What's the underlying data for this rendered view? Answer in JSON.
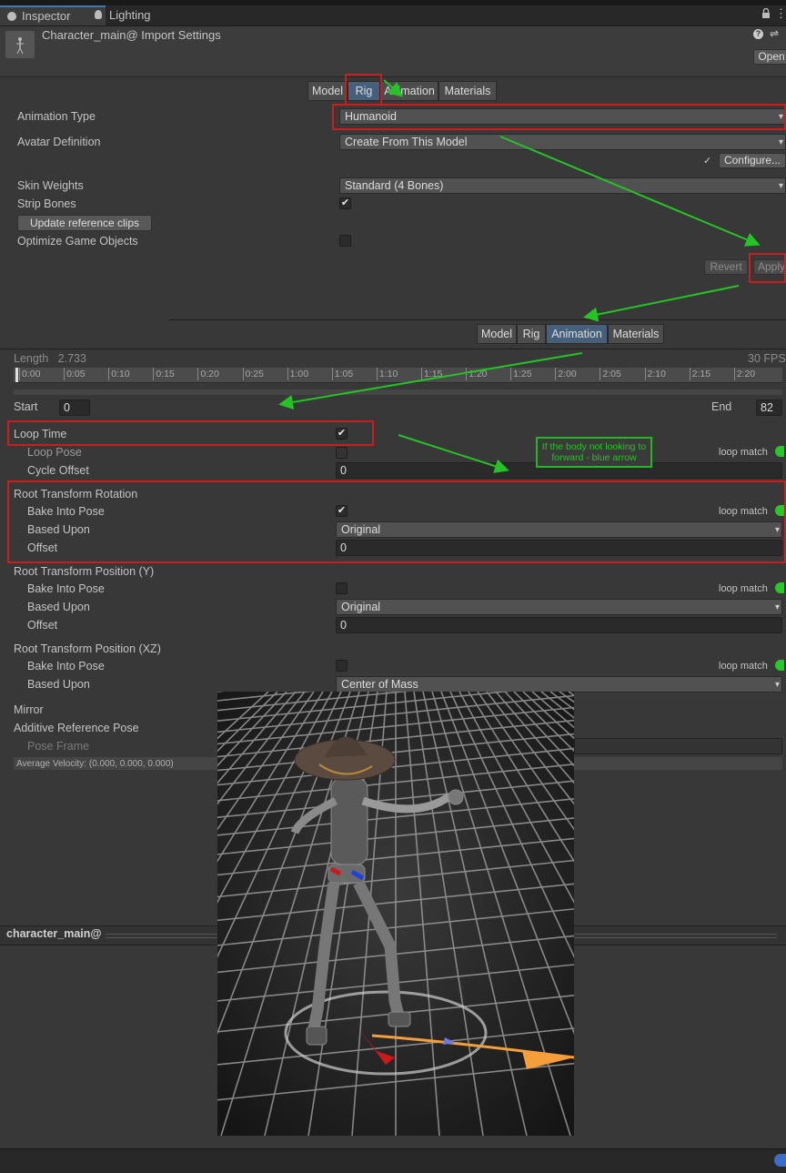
{
  "tabs": [
    {
      "label": "Inspector",
      "icon": "info-icon"
    },
    {
      "label": "Lighting",
      "icon": "lightbulb-icon"
    }
  ],
  "header": {
    "title": "Character_main@ Import Settings",
    "open_label": "Open"
  },
  "rig_section": {
    "tabs": [
      "Model",
      "Rig",
      "Animation",
      "Materials"
    ],
    "selected": "Rig",
    "animation_type_label": "Animation Type",
    "animation_type_value": "Humanoid",
    "avatar_definition_label": "Avatar Definition",
    "avatar_definition_value": "Create From This Model",
    "configure_label": "Configure...",
    "skin_weights_label": "Skin Weights",
    "skin_weights_value": "Standard (4 Bones)",
    "strip_bones_label": "Strip Bones",
    "update_clips_label": "Update reference clips",
    "optimize_label": "Optimize Game Objects",
    "revert_label": "Revert",
    "apply_label": "Apply"
  },
  "anim_section": {
    "tabs": [
      "Model",
      "Rig",
      "Animation",
      "Materials"
    ],
    "selected": "Animation",
    "length_label": "Length",
    "length_value": "2.733",
    "fps_label": "30 FPS",
    "timeline_ticks": [
      "0:00",
      "0:05",
      "0:10",
      "0:15",
      "0:20",
      "0:25",
      "1:00",
      "1:05",
      "1:10",
      "1:15",
      "1:20",
      "1:25",
      "2:00",
      "2:05",
      "2:10",
      "2:15",
      "2:20"
    ],
    "start_label": "Start",
    "start_value": "0",
    "end_label": "End",
    "end_value": "82",
    "loop_time_label": "Loop Time",
    "loop_pose_label": "Loop Pose",
    "loop_match_label": "loop match",
    "cycle_offset_label": "Cycle Offset",
    "cycle_offset_value": "0",
    "root_rotation_label": "Root Transform Rotation",
    "bake_into_pose_label": "Bake Into Pose",
    "based_upon_label": "Based Upon",
    "offset_label": "Offset",
    "rotation_based_value": "Original",
    "rotation_offset_value": "0",
    "root_pos_y_label": "Root Transform Position (Y)",
    "pos_y_based_value": "Original",
    "pos_y_offset_value": "0",
    "root_pos_xz_label": "Root Transform Position (XZ)",
    "pos_xz_based_value": "Center of Mass",
    "mirror_label": "Mirror",
    "additive_label": "Additive Reference Pose",
    "pose_frame_label": "Pose Frame",
    "avg_velocity": "Average Velocity: (0.000, 0.000, 0.000)"
  },
  "annotation_note": "If the body not looking to forward - blue arrow",
  "preview_title": "character_main@",
  "colors": {
    "annotation_red": "#c81e1e",
    "annotation_green": "#23b823",
    "selected_tab": "#46607c",
    "loop_match_green": "#26c926"
  }
}
